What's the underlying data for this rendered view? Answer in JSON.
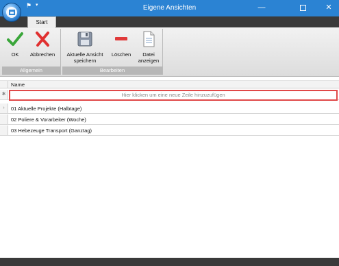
{
  "window": {
    "title": "Eigene Ansichten",
    "minimize_glyph": "—",
    "close_glyph": "✕"
  },
  "quick_access": {
    "dropdown_glyph": "▾"
  },
  "ribbon": {
    "active_tab": "Start",
    "groups": [
      {
        "label": "Allgemein",
        "buttons": [
          {
            "label": "OK",
            "icon": "checkmark-icon"
          },
          {
            "label": "Abbrechen",
            "icon": "red-x-icon"
          }
        ]
      },
      {
        "label": "Bearbeiten",
        "buttons": [
          {
            "label_line1": "Aktuelle Ansicht",
            "label_line2": "speichern",
            "icon": "floppy-disk-icon"
          },
          {
            "label": "Löschen",
            "icon": "red-minus-icon"
          },
          {
            "label_line1": "Datei",
            "label_line2": "anzeigen",
            "icon": "document-icon"
          }
        ]
      }
    ]
  },
  "grid": {
    "column_header": "Name",
    "new_row_placeholder": "Hier klicken um eine neue Zeile hinzuzufügen",
    "new_row_marker": "✱",
    "current_row_marker": "›",
    "rows": [
      "01 Aktuelle Projekte (Halbtage)",
      "02 Poliere & Vorarbeiter (Woche)",
      "03 Hebezeuge Transport (Ganztag)"
    ]
  },
  "colors": {
    "titlebar": "#2b83d3",
    "accent_red": "#e04848",
    "ok_green": "#3aa63a"
  }
}
